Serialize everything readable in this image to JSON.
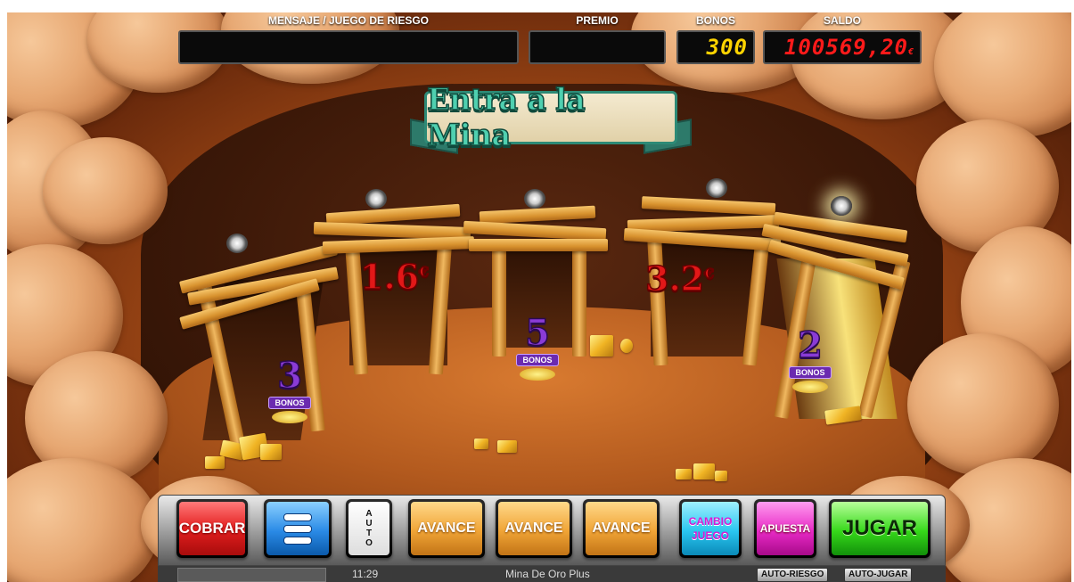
{
  "header": {
    "message_label": "MENSAJE / JUEGO DE RIESGO",
    "message_value": "",
    "prize_label": "PREMIO",
    "prize_value": "",
    "bonus_label": "BONOS",
    "bonus_value": "300",
    "balance_label": "SALDO",
    "balance_value": "100569,20",
    "balance_currency": "€"
  },
  "banner": {
    "title": "Entra a la Mina"
  },
  "mines": [
    {
      "bonus_count": "3",
      "bonus_label": "BONOS"
    },
    {
      "prize": "1.6",
      "currency": "€"
    },
    {
      "bonus_count": "5",
      "bonus_label": "BONOS"
    },
    {
      "prize": "3.2",
      "currency": "€"
    },
    {
      "bonus_count": "2",
      "bonus_label": "BONOS"
    }
  ],
  "controls": {
    "collect": "COBRAR",
    "auto": [
      "A",
      "U",
      "T",
      "O"
    ],
    "advance": [
      "AVANCE",
      "AVANCE",
      "AVANCE"
    ],
    "change_game_line1": "CAMBIO",
    "change_game_line2": "JUEGO",
    "bet": "APUESTA",
    "play": "JUGAR"
  },
  "status_bar": {
    "progress": 0.0,
    "time": "11:29",
    "game_name": "Mina De Oro Plus",
    "auto_risk": "AUTO-RIESGO",
    "auto_play": "AUTO-JUGAR"
  },
  "colors": {
    "bonus_digits": "#ffd400",
    "balance_digits": "#ff1a1a",
    "prize_text": "#e21818",
    "bonus_text": "#8a3bd6"
  }
}
